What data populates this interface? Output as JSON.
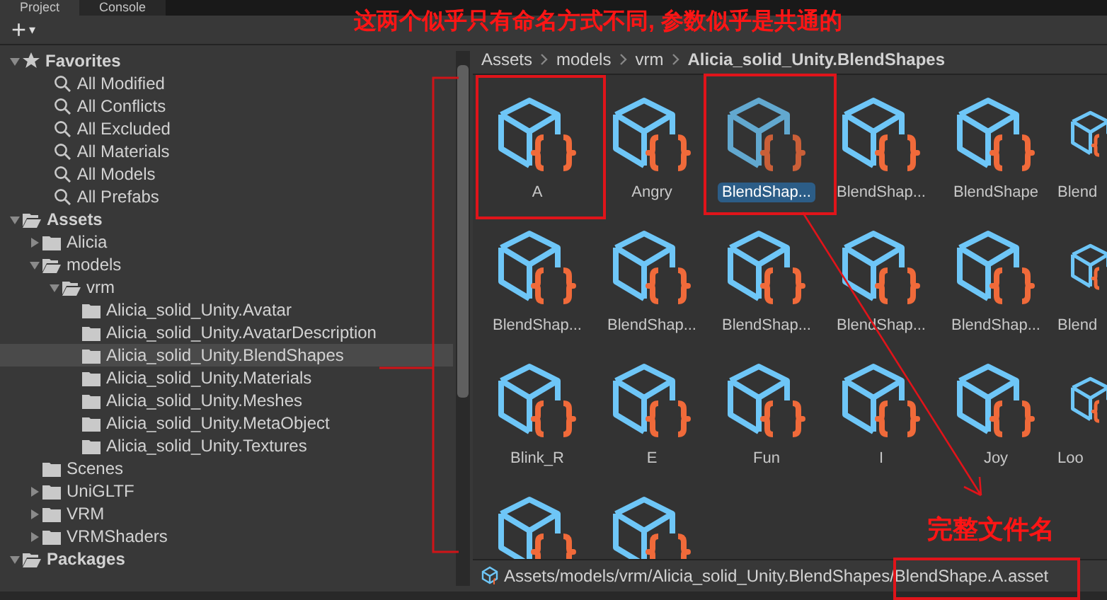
{
  "tabs": [
    {
      "label": "Project",
      "selected": true
    },
    {
      "label": "Console",
      "selected": false
    }
  ],
  "toolbar": {
    "add": "+",
    "caret": "▾"
  },
  "tree": [
    {
      "label": "Favorites",
      "kind": "favorites",
      "expanded": true,
      "selected": false,
      "children": [
        {
          "label": "All Modified",
          "kind": "search",
          "selected": false
        },
        {
          "label": "All Conflicts",
          "kind": "search",
          "selected": false
        },
        {
          "label": "All Excluded",
          "kind": "search",
          "selected": false
        },
        {
          "label": "All Materials",
          "kind": "search",
          "selected": false
        },
        {
          "label": "All Models",
          "kind": "search",
          "selected": false
        },
        {
          "label": "All Prefabs",
          "kind": "search",
          "selected": false
        }
      ]
    },
    {
      "label": "Assets",
      "kind": "root",
      "expanded": true,
      "selected": false,
      "children": [
        {
          "label": "Alicia",
          "kind": "folder",
          "expanded": false,
          "selected": false
        },
        {
          "label": "models",
          "kind": "folder",
          "expanded": true,
          "selected": false,
          "children": [
            {
              "label": "vrm",
              "kind": "folder",
              "expanded": true,
              "selected": false,
              "children": [
                {
                  "label": "Alicia_solid_Unity.Avatar",
                  "kind": "folder",
                  "selected": false
                },
                {
                  "label": "Alicia_solid_Unity.AvatarDescription",
                  "kind": "folder",
                  "selected": false
                },
                {
                  "label": "Alicia_solid_Unity.BlendShapes",
                  "kind": "folder",
                  "selected": true
                },
                {
                  "label": "Alicia_solid_Unity.Materials",
                  "kind": "folder",
                  "selected": false
                },
                {
                  "label": "Alicia_solid_Unity.Meshes",
                  "kind": "folder",
                  "selected": false
                },
                {
                  "label": "Alicia_solid_Unity.MetaObject",
                  "kind": "folder",
                  "selected": false
                },
                {
                  "label": "Alicia_solid_Unity.Textures",
                  "kind": "folder",
                  "selected": false
                }
              ]
            }
          ]
        },
        {
          "label": "Scenes",
          "kind": "folder",
          "selected": false
        },
        {
          "label": "UniGLTF",
          "kind": "folder",
          "expanded": false,
          "selected": false
        },
        {
          "label": "VRM",
          "kind": "folder",
          "expanded": false,
          "selected": false
        },
        {
          "label": "VRMShaders",
          "kind": "folder",
          "expanded": false,
          "selected": false
        }
      ]
    },
    {
      "label": "Packages",
      "kind": "root",
      "expanded": true,
      "selected": false
    }
  ],
  "breadcrumb": [
    "Assets",
    "models",
    "vrm",
    "Alicia_solid_Unity.BlendShapes"
  ],
  "assets": [
    {
      "label": "A",
      "selected": false
    },
    {
      "label": "Angry",
      "selected": false
    },
    {
      "label": "BlendShap...",
      "selected": true
    },
    {
      "label": "BlendShap...",
      "selected": false
    },
    {
      "label": "BlendShape",
      "selected": false
    },
    {
      "label": "Blend",
      "selected": false
    },
    {
      "label": "BlendShap...",
      "selected": false
    },
    {
      "label": "BlendShap...",
      "selected": false
    },
    {
      "label": "BlendShap...",
      "selected": false
    },
    {
      "label": "BlendShap...",
      "selected": false
    },
    {
      "label": "BlendShap...",
      "selected": false
    },
    {
      "label": "Blend",
      "selected": false
    },
    {
      "label": "Blink_R",
      "selected": false
    },
    {
      "label": "E",
      "selected": false
    },
    {
      "label": "Fun",
      "selected": false
    },
    {
      "label": "I",
      "selected": false
    },
    {
      "label": "Joy",
      "selected": false
    },
    {
      "label": "Loo",
      "selected": false
    },
    {
      "selected": false
    },
    {
      "selected": false
    }
  ],
  "path_bar": "Assets/models/vrm/Alicia_solid_Unity.BlendShapes/BlendShape.A.asset",
  "annotations": {
    "note": "这两个似乎只有命名方式不同, 参数似乎是共通的",
    "label": "完整文件名"
  }
}
